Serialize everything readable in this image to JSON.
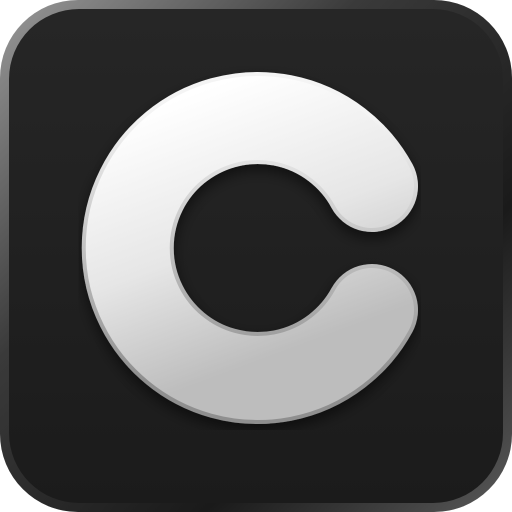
{
  "icon": {
    "name": "letter-c-app-icon",
    "glyph": "C",
    "colors": {
      "background_dark": "#1c1c1c",
      "background_mid": "#262626",
      "bezel_light": "#8a8a8a",
      "bezel_dark": "#141414",
      "letter_light": "#ffffff",
      "letter_shade": "#b8b8b8"
    }
  }
}
